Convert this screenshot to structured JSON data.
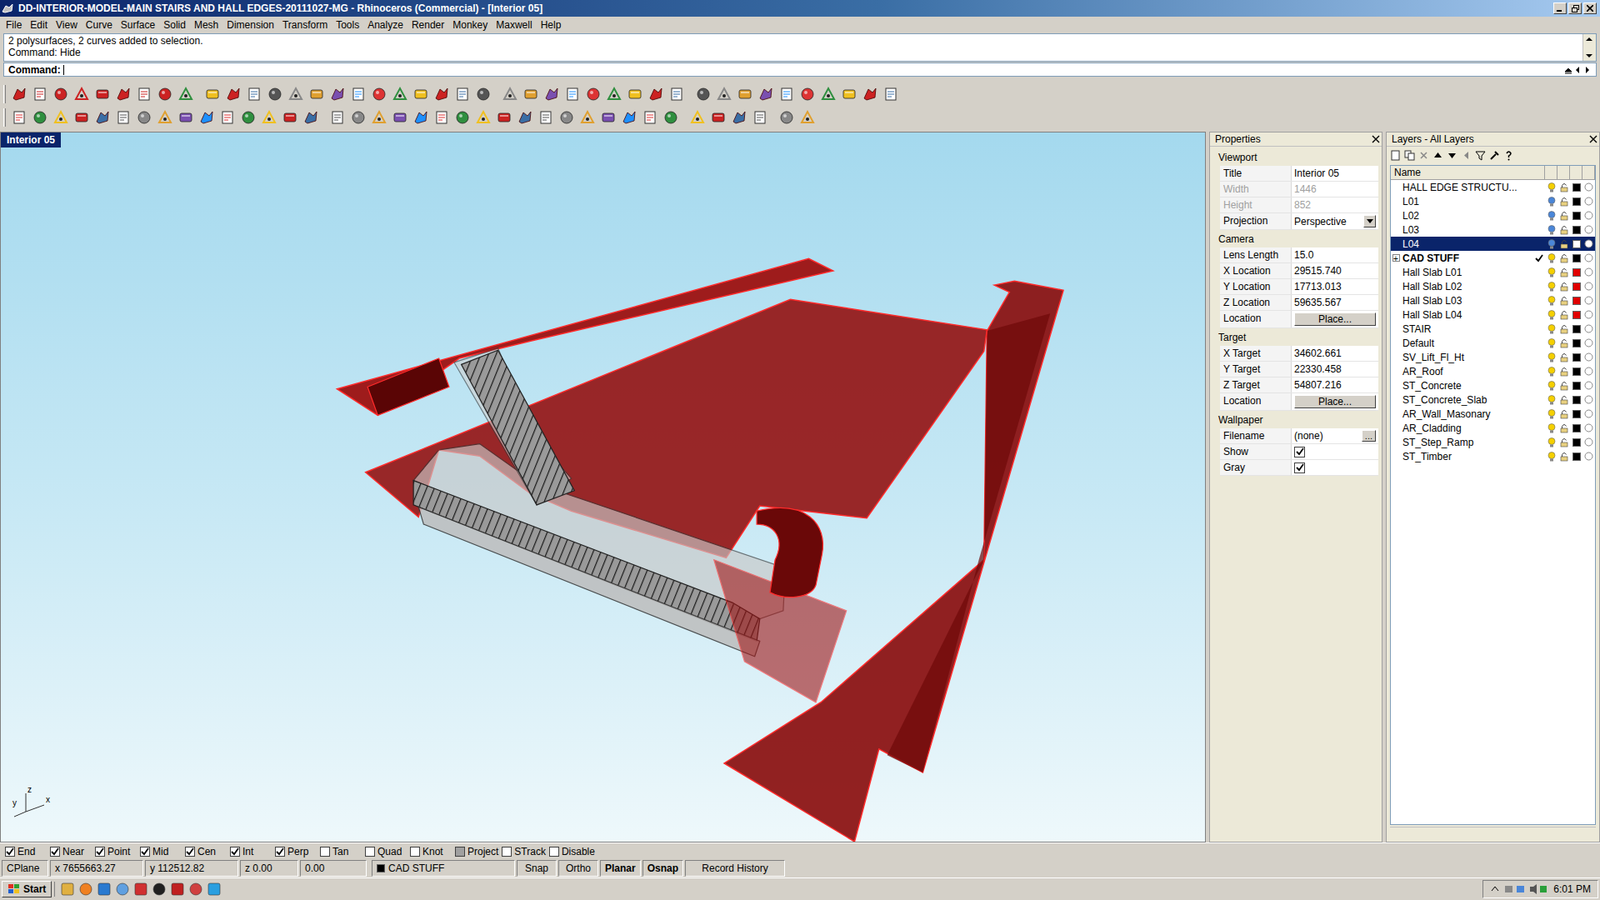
{
  "window": {
    "title": "DD-INTERIOR-MODEL-MAIN STAIRS AND HALL EDGES-20111027-MG - Rhinoceros (Commercial) - [Interior 05]"
  },
  "menu": [
    "File",
    "Edit",
    "View",
    "Curve",
    "Surface",
    "Solid",
    "Mesh",
    "Dimension",
    "Transform",
    "Tools",
    "Analyze",
    "Render",
    "Monkey",
    "Maxwell",
    "Help"
  ],
  "command": {
    "history": [
      "2 polysurfaces, 2 curves added to selection.",
      "Command: Hide"
    ],
    "prompt": "Command:"
  },
  "viewport": {
    "title": "Interior 05",
    "axes": [
      "z",
      "y",
      "x"
    ]
  },
  "properties": {
    "title": "Properties",
    "sections": [
      {
        "heading": "Viewport",
        "rows": [
          {
            "label": "Title",
            "value": "Interior 05",
            "kind": "text",
            "disabled": false
          },
          {
            "label": "Width",
            "value": "1446",
            "kind": "text",
            "disabled": true
          },
          {
            "label": "Height",
            "value": "852",
            "kind": "text",
            "disabled": true
          },
          {
            "label": "Projection",
            "value": "Perspective",
            "kind": "dropdown",
            "disabled": false
          }
        ]
      },
      {
        "heading": "Camera",
        "rows": [
          {
            "label": "Lens Length",
            "value": "15.0",
            "kind": "text",
            "disabled": false
          },
          {
            "label": "X Location",
            "value": "29515.740",
            "kind": "text",
            "disabled": false
          },
          {
            "label": "Y Location",
            "value": "17713.013",
            "kind": "text",
            "disabled": false
          },
          {
            "label": "Z Location",
            "value": "59635.567",
            "kind": "text",
            "disabled": false
          },
          {
            "label": "Location",
            "value": "Place...",
            "kind": "button",
            "disabled": false
          }
        ]
      },
      {
        "heading": "Target",
        "rows": [
          {
            "label": "X Target",
            "value": "34602.661",
            "kind": "text",
            "disabled": false
          },
          {
            "label": "Y Target",
            "value": "22330.458",
            "kind": "text",
            "disabled": false
          },
          {
            "label": "Z Target",
            "value": "54807.216",
            "kind": "text",
            "disabled": false
          },
          {
            "label": "Location",
            "value": "Place...",
            "kind": "button",
            "disabled": false
          }
        ]
      },
      {
        "heading": "Wallpaper",
        "rows": [
          {
            "label": "Filename",
            "value": "(none)",
            "button": "...",
            "kind": "browse",
            "disabled": false
          },
          {
            "label": "Show",
            "kind": "checkbox",
            "checked": true,
            "disabled": false
          },
          {
            "label": "Gray",
            "kind": "checkbox",
            "checked": true,
            "disabled": false
          }
        ]
      }
    ]
  },
  "layers": {
    "title": "Layers - All Layers",
    "column": "Name",
    "rows": [
      {
        "name": "HALL EDGE STRUCTU...",
        "expander": null,
        "on": true,
        "locked": false,
        "color": "#000000",
        "current": false,
        "selected": false
      },
      {
        "name": "L01",
        "expander": null,
        "on": false,
        "locked": false,
        "color": "#000000",
        "current": false,
        "selected": false
      },
      {
        "name": "L02",
        "expander": null,
        "on": false,
        "locked": false,
        "color": "#000000",
        "current": false,
        "selected": false
      },
      {
        "name": "L03",
        "expander": null,
        "on": false,
        "locked": false,
        "color": "#000000",
        "current": false,
        "selected": false
      },
      {
        "name": "L04",
        "expander": null,
        "on": false,
        "locked": false,
        "color": "#ffffff",
        "current": false,
        "selected": true
      },
      {
        "name": "CAD STUFF",
        "expander": "+",
        "on": true,
        "locked": false,
        "color": "#000000",
        "current": true,
        "selected": false
      },
      {
        "name": "Hall Slab L01",
        "expander": null,
        "on": true,
        "locked": false,
        "color": "#e00000",
        "current": false,
        "selected": false
      },
      {
        "name": "Hall Slab L02",
        "expander": null,
        "on": true,
        "locked": false,
        "color": "#e00000",
        "current": false,
        "selected": false
      },
      {
        "name": "Hall Slab L03",
        "expander": null,
        "on": true,
        "locked": false,
        "color": "#e00000",
        "current": false,
        "selected": false
      },
      {
        "name": "Hall Slab L04",
        "expander": null,
        "on": true,
        "locked": false,
        "color": "#e00000",
        "current": false,
        "selected": false
      },
      {
        "name": "STAIR",
        "expander": null,
        "on": true,
        "locked": false,
        "color": "#000000",
        "current": false,
        "selected": false
      },
      {
        "name": "Default",
        "expander": null,
        "on": true,
        "locked": false,
        "color": "#000000",
        "current": false,
        "selected": false
      },
      {
        "name": "SV_Lift_Fl_Ht",
        "expander": null,
        "on": true,
        "locked": false,
        "color": "#000000",
        "current": false,
        "selected": false
      },
      {
        "name": "AR_Roof",
        "expander": null,
        "on": true,
        "locked": false,
        "color": "#000000",
        "current": false,
        "selected": false
      },
      {
        "name": "ST_Concrete",
        "expander": null,
        "on": true,
        "locked": false,
        "color": "#000000",
        "current": false,
        "selected": false
      },
      {
        "name": "ST_Concrete_Slab",
        "expander": null,
        "on": true,
        "locked": false,
        "color": "#000000",
        "current": false,
        "selected": false
      },
      {
        "name": "AR_Wall_Masonary",
        "expander": null,
        "on": true,
        "locked": false,
        "color": "#000000",
        "current": false,
        "selected": false
      },
      {
        "name": "AR_Cladding",
        "expander": null,
        "on": true,
        "locked": false,
        "color": "#000000",
        "current": false,
        "selected": false
      },
      {
        "name": "ST_Step_Ramp",
        "expander": null,
        "on": true,
        "locked": false,
        "color": "#000000",
        "current": false,
        "selected": false
      },
      {
        "name": "ST_Timber",
        "expander": null,
        "on": true,
        "locked": false,
        "color": "#000000",
        "current": false,
        "selected": false
      }
    ]
  },
  "osnaps": [
    {
      "label": "End",
      "checked": true,
      "disabled": false
    },
    {
      "label": "Near",
      "checked": true,
      "disabled": false
    },
    {
      "label": "Point",
      "checked": true,
      "disabled": false
    },
    {
      "label": "Mid",
      "checked": true,
      "disabled": false
    },
    {
      "label": "Cen",
      "checked": true,
      "disabled": false
    },
    {
      "label": "Int",
      "checked": true,
      "disabled": false
    },
    {
      "label": "Perp",
      "checked": true,
      "disabled": false
    },
    {
      "label": "Tan",
      "checked": false,
      "disabled": false
    },
    {
      "label": "Quad",
      "checked": false,
      "disabled": false
    },
    {
      "label": "Knot",
      "checked": false,
      "disabled": false
    },
    {
      "label": "Project",
      "checked": false,
      "disabled": true
    },
    {
      "label": "STrack",
      "checked": false,
      "disabled": false
    },
    {
      "label": "Disable",
      "checked": false,
      "disabled": false
    }
  ],
  "status_bar": {
    "cplane": "CPlane",
    "x": "x 7655663.27",
    "y": "y 112512.82",
    "z": "z 0.00",
    "distance": "0.00",
    "layer": "CAD STUFF",
    "layer_color": "#000000",
    "toggles": [
      {
        "label": "Snap",
        "on": false
      },
      {
        "label": "Ortho",
        "on": false
      },
      {
        "label": "Planar",
        "on": true
      },
      {
        "label": "Osnap",
        "on": true
      },
      {
        "label": "Record History",
        "on": false
      }
    ]
  },
  "taskbar": {
    "start": "Start",
    "clock": "6:01 PM"
  }
}
